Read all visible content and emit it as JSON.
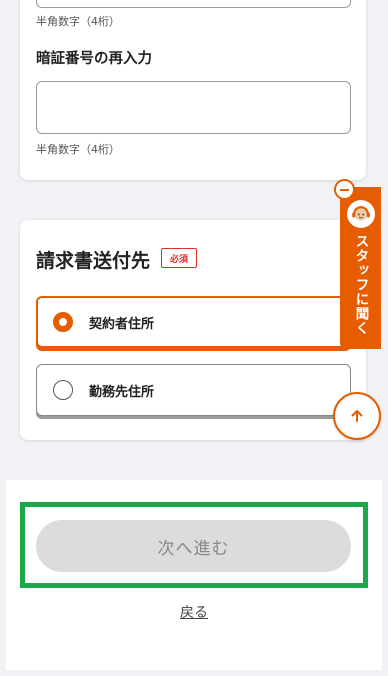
{
  "pin_section": {
    "top_hint": "半角数字（4桁）",
    "confirm_label": "暗証番号の再入力",
    "confirm_value": "",
    "confirm_hint": "半角数字（4桁）"
  },
  "billing": {
    "title": "請求書送付先",
    "required_badge": "必須",
    "options": [
      {
        "label": "契約者住所",
        "selected": true
      },
      {
        "label": "勤務先住所",
        "selected": false
      }
    ]
  },
  "staff_tab": {
    "label": "スタッフに聞く",
    "icon": "headset-person-icon"
  },
  "scroll_top": {
    "icon": "arrow-up-icon"
  },
  "footer": {
    "next_label": "次へ進む",
    "back_label": "戻る"
  },
  "colors": {
    "accent": "#e65c00",
    "required": "#e0302c",
    "highlight": "#1aa84a",
    "disabled_button": "#dcdcdc"
  }
}
